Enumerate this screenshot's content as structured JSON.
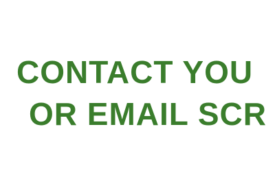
{
  "banner": {
    "line1": "CONTACT YOU",
    "line2": "OR EMAIL SCR"
  },
  "colors": {
    "background": "#ffffff",
    "text": "#3a7d2c"
  }
}
